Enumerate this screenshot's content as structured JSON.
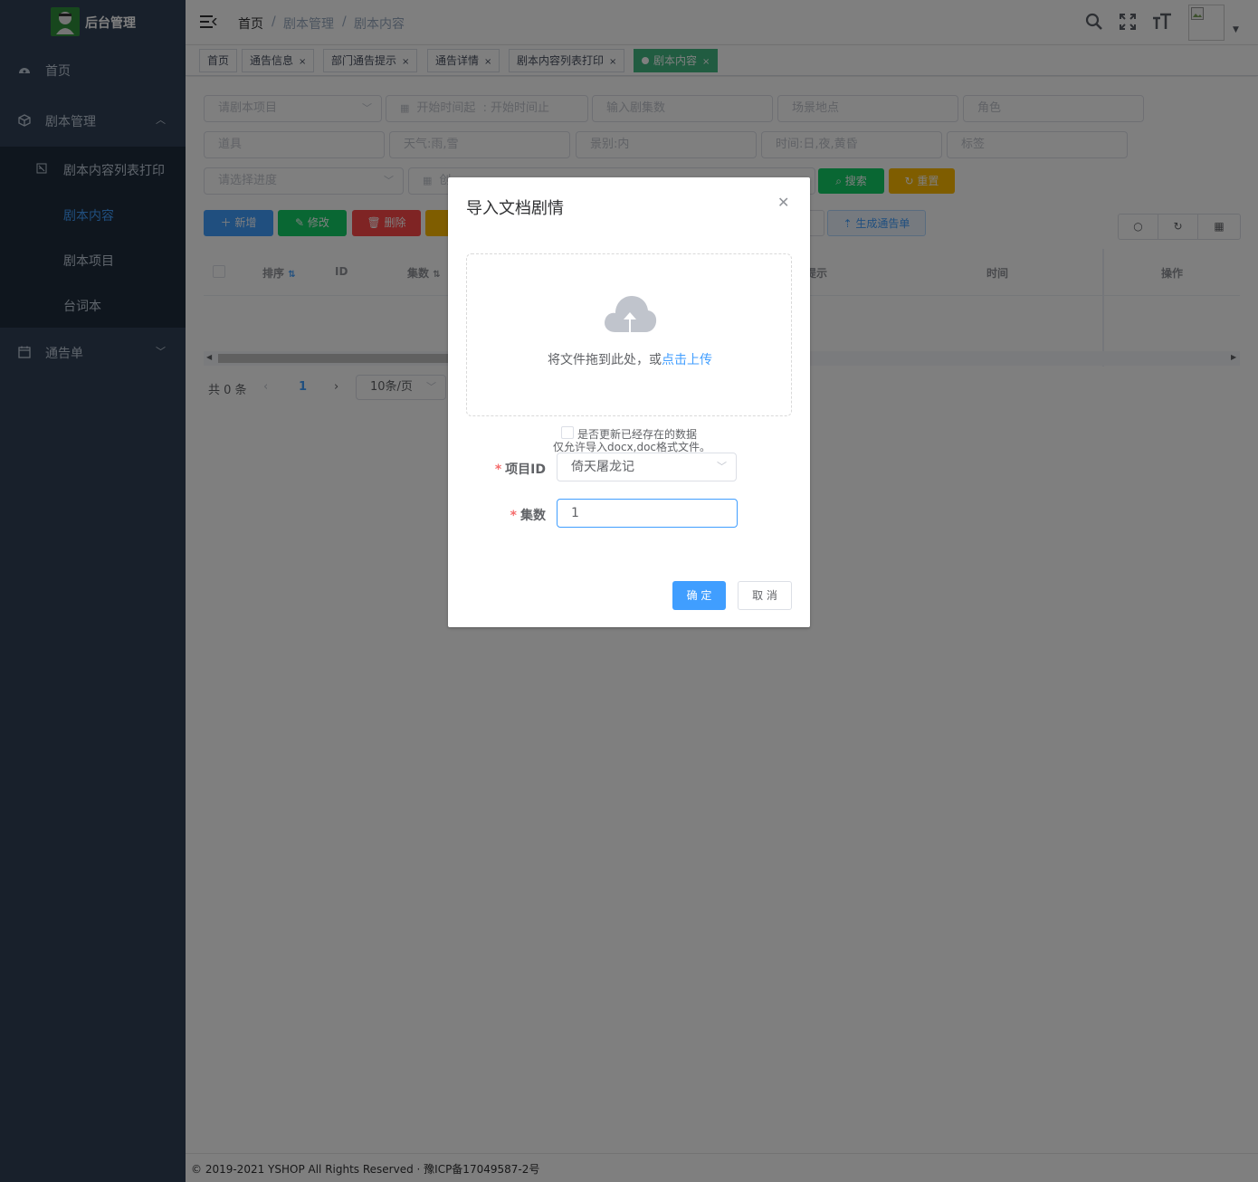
{
  "sidebar": {
    "logo_text": "后台管理",
    "items": [
      {
        "label": "首页"
      },
      {
        "label": "剧本管理"
      },
      {
        "label": "通告单"
      }
    ],
    "sub_items": [
      {
        "label": "剧本内容列表打印"
      },
      {
        "label": "剧本内容"
      },
      {
        "label": "剧本项目"
      },
      {
        "label": "台词本"
      }
    ]
  },
  "navbar": {
    "breadcrumb": [
      "首页",
      "/",
      "剧本管理",
      "/",
      "剧本内容"
    ]
  },
  "tags": [
    {
      "label": "首页"
    },
    {
      "label": "通告信息"
    },
    {
      "label": "部门通告提示"
    },
    {
      "label": "通告详情"
    },
    {
      "label": "剧本内容列表打印"
    },
    {
      "label": "剧本内容"
    }
  ],
  "filters": {
    "project_placeholder": "请剧本项目",
    "date_start": "开始时间起",
    "date_sep": ":",
    "date_end": "开始时间止",
    "episode_placeholder": "输入剧集数",
    "scene_placeholder": "场景地点",
    "role_placeholder": "角色",
    "prop_placeholder": "道具",
    "weather_placeholder": "天气:雨,雪",
    "view_placeholder": "景别:内",
    "time_placeholder": "时间:日,夜,黄昏",
    "label_placeholder": "标签",
    "progress_placeholder": "请选择进度",
    "date2_partial": "创"
  },
  "buttons": {
    "search": "搜索",
    "reset": "重置",
    "add": "新增",
    "edit": "修改",
    "delete": "删除",
    "generate": "生成通告单"
  },
  "table": {
    "headers": [
      "排序",
      "ID",
      "集数",
      "提示",
      "时间",
      "操作"
    ]
  },
  "pagination": {
    "total": "共 0 条",
    "page": "1",
    "size": "10条/页"
  },
  "dialog": {
    "title": "导入文档剧情",
    "upload_text": "将文件拖到此处，或",
    "upload_link": "点击上传",
    "checkbox_label": "是否更新已经存在的数据",
    "tip": "仅允许导入docx,doc格式文件。",
    "project_label": "项目ID",
    "project_value": "倚天屠龙记",
    "episode_label": "集数",
    "episode_value": "1",
    "confirm": "确 定",
    "cancel": "取 消"
  },
  "footer": {
    "text": "© 2019-2021 YSHOP All Rights Reserved · 豫ICP备17049587-2号"
  },
  "colors": {
    "sidebar_bg": "#304156",
    "submenu_bg": "#1f2d3d",
    "primary": "#409eff",
    "success": "#13ce66",
    "warning": "#ffba00",
    "danger": "#ff4949",
    "tag_active": "#42b983"
  }
}
